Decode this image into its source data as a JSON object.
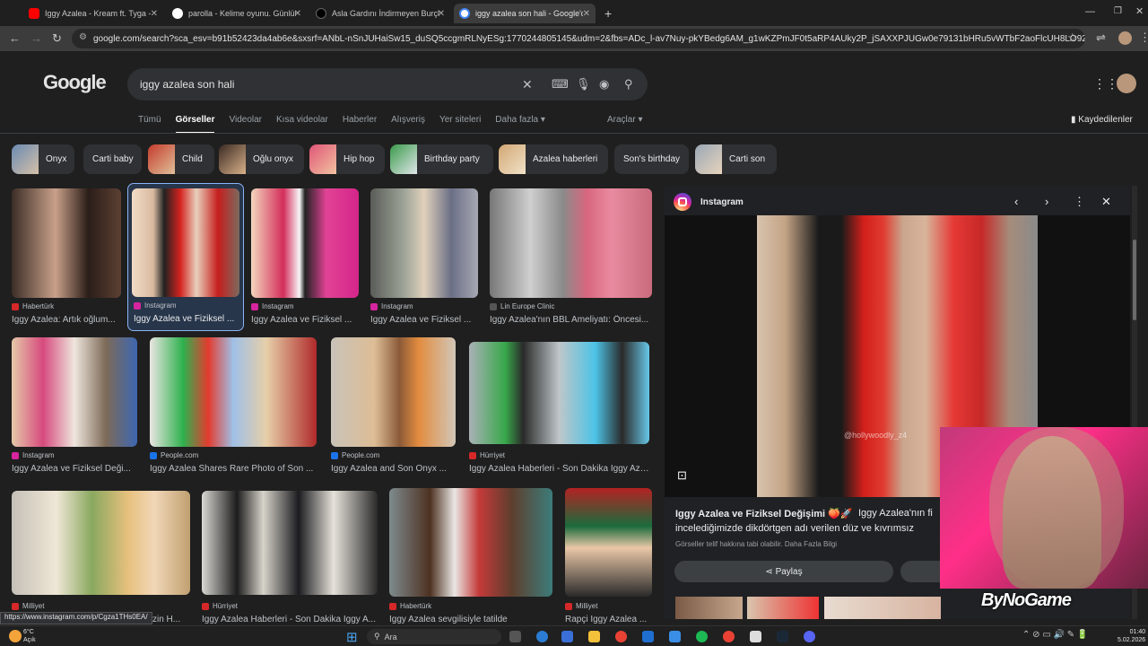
{
  "tabs": [
    {
      "title": "Iggy Azalea - Kream ft. Tyga - Y",
      "color": "#ff0000"
    },
    {
      "title": "parolla - Kelime oyunu. Günlük",
      "color": "#ffffff"
    },
    {
      "title": "Asla Gardını İndirmeyen Burçla",
      "color": "#111111"
    },
    {
      "title": "iggy azalea son hali - Google'd",
      "color": "#4285f4"
    }
  ],
  "new_tab_label": "+",
  "address_url": "google.com/search?sca_esv=b91b52423da4ab6e&sxsrf=ANbL-nSnJUHaiSw15_duSQ5ccgmRLNyESg:1770244805145&udm=2&fbs=ADc_l-av7Nuy-pkYBedg6AM_g1wKZPmJF0t5aRP4AUky2P_jSAXXPJUGw0e79131bHRu5vWTbF2aoFlcUH8LO92vcJatSGfQEr_JG...",
  "logo_text": "Google",
  "search": {
    "query": "iggy azalea son hali"
  },
  "nav_tabs": [
    "Tümü",
    "Görseller",
    "Videolar",
    "Kısa videolar",
    "Haberler",
    "Alışveriş",
    "Yer siteleri",
    "Daha fazla ▾"
  ],
  "tools_label": "Araçlar ▾",
  "saved_label": "Kaydedilenler",
  "chips": [
    "Onyx",
    "Carti baby",
    "Child",
    "Oğlu onyx",
    "Hip hop",
    "Birthday party",
    "Azalea haberleri",
    "Son's birthday",
    "Carti son"
  ],
  "results": [
    {
      "source": "Habertürk",
      "title": "Iggy Azalea: Artık oğlum...",
      "src_color": "#d62828"
    },
    {
      "source": "Instagram",
      "title": "Iggy Azalea ve Fiziksel ...",
      "src_color": "#d6249f"
    },
    {
      "source": "Instagram",
      "title": "Iggy Azalea ve Fiziksel ...",
      "src_color": "#d6249f"
    },
    {
      "source": "Instagram",
      "title": "Iggy Azalea ve Fiziksel ...",
      "src_color": "#d6249f"
    },
    {
      "source": "Lin Europe Clinic",
      "title": "Iggy Azalea'nın BBL Ameliyatı: Öncesi...",
      "src_color": "#555555"
    },
    {
      "source": "Instagram",
      "title": "Iggy Azalea ve Fiziksel Deği...",
      "src_color": "#d6249f"
    },
    {
      "source": "People.com",
      "title": "Iggy Azalea Shares Rare Photo of Son ...",
      "src_color": "#1a73e8"
    },
    {
      "source": "People.com",
      "title": "Iggy Azalea and Son Onyx ...",
      "src_color": "#1a73e8"
    },
    {
      "source": "Hürriyet",
      "title": "Iggy Azalea Haberleri - Son Dakika İggy Aza...",
      "src_color": "#d62828"
    },
    {
      "source": "Milliyet",
      "title": "zin H...",
      "src_color": "#d62828"
    },
    {
      "source": "Hürriyet",
      "title": "Iggy Azalea Haberleri - Son Dakika İggy A...",
      "src_color": "#d62828"
    },
    {
      "source": "Habertürk",
      "title": "Iggy Azalea sevgilisiyle tatilde",
      "src_color": "#d62828"
    },
    {
      "source": "Milliyet",
      "title": "Rapçi Iggy Azalea ...",
      "src_color": "#d62828"
    }
  ],
  "preview": {
    "source": "Instagram",
    "title": "Iggy Azalea ve Fiziksel Değişimi",
    "desc": "Iggy Azalea'nın fi",
    "desc2": "incelediğimizde dikdörtgen adı verilen düz ve kıvrımsız",
    "copyright": "Görseller telif hakkına tabi olabilir. Daha Fazla Bilgi",
    "share_label": "Paylaş",
    "watermark": "@hollywoodly_z4"
  },
  "status_link": "https://www.instagram.com/p/Cgza1THs0EA/",
  "stream_logo": "ByNoGame",
  "taskbar": {
    "weather_temp": "6°C",
    "weather_desc": "Açık",
    "search_placeholder": "Ara",
    "time": "01:40",
    "date": "5.02.2026"
  }
}
